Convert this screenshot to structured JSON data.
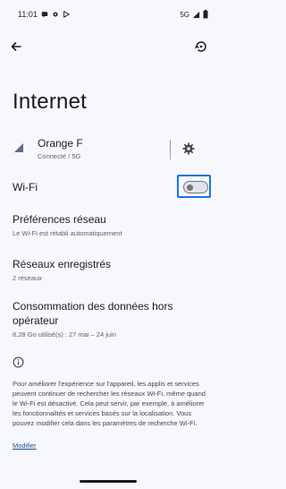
{
  "statusbar": {
    "time": "11:01",
    "network": "5G"
  },
  "page": {
    "title": "Internet"
  },
  "carrier": {
    "name": "Orange F",
    "status": "Connecté / 5G"
  },
  "wifi": {
    "label": "Wi-Fi",
    "enabled": false
  },
  "network_prefs": {
    "title": "Préférences réseau",
    "subtitle": "Le Wi-Fi est rétabli automatiquement"
  },
  "saved_networks": {
    "title": "Réseaux enregistrés",
    "subtitle": "2 réseaux"
  },
  "data_usage": {
    "title_line1": "Consommation des données hors",
    "title_line2": "opérateur",
    "subtitle": "8,28 Go utilisé(s) : 27 mai – 24 juin"
  },
  "footer": {
    "text": "Pour améliorer l'expérience sur l'appareil, les applis et services peuvent continuer de rechercher les réseaux Wi-Fi, même quand le Wi-Fi est désactivé. Cela peut servir, par exemple, à améliorer les fonctionnalités et services basés sur la localisation. Vous pouvez modifier cela dans les paramètres de recherche Wi-Fi.",
    "link": "Modifier"
  },
  "colors": {
    "background": "#f6f8fb",
    "accent_focus": "#1a73e8",
    "link": "#1f4f9c"
  },
  "icons": {
    "back": "arrow-left",
    "help": "help-refresh",
    "signal": "signal-triangle",
    "settings": "gear"
  }
}
